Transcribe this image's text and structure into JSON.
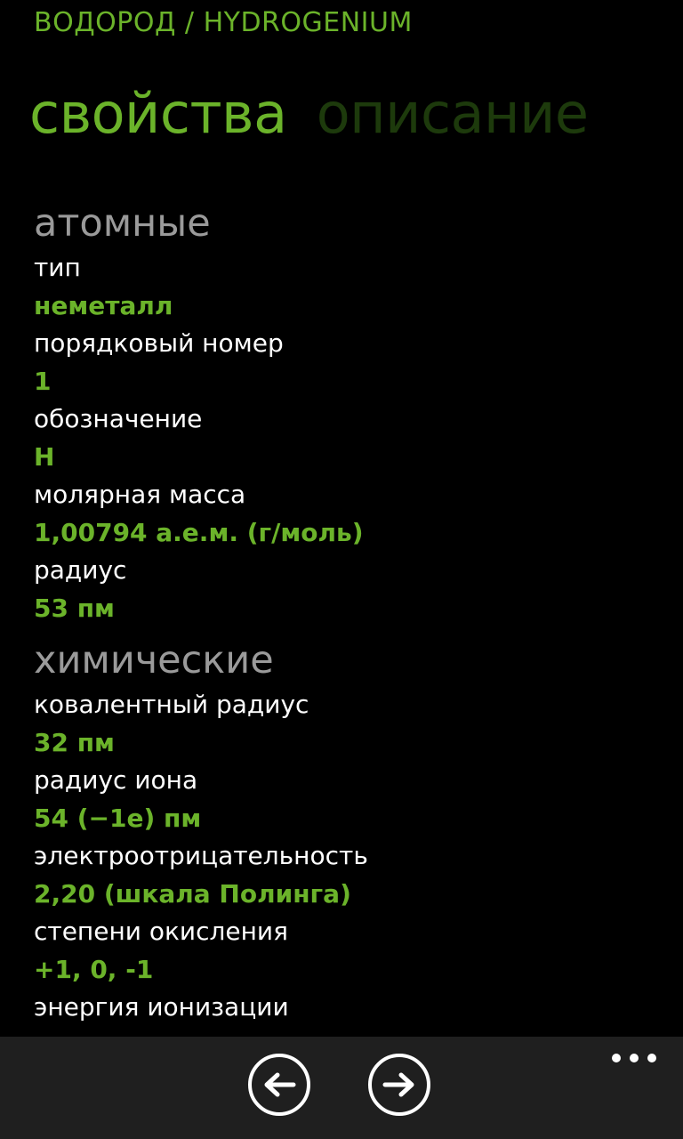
{
  "app": {
    "title": "ВОДОРОД / HYDROGENIUM"
  },
  "pivot": {
    "tabs": [
      {
        "label": "свойства",
        "active": true
      },
      {
        "label": "описание",
        "active": false
      }
    ]
  },
  "sections": [
    {
      "title": "атомные",
      "properties": [
        {
          "label": "тип",
          "value": "неметалл"
        },
        {
          "label": "порядковый номер",
          "value": "1"
        },
        {
          "label": "обозначение",
          "value": "H"
        },
        {
          "label": "молярная масса",
          "value": "1,00794 а.е.м. (г/моль)"
        },
        {
          "label": "радиус",
          "value": "53 пм"
        }
      ]
    },
    {
      "title": "химические",
      "properties": [
        {
          "label": "ковалентный радиус",
          "value": "32 пм"
        },
        {
          "label": "радиус иона",
          "value": "54 (−1e) пм"
        },
        {
          "label": "электроотрицательность",
          "value": "2,20 (шкала Полинга)"
        },
        {
          "label": "степени окисления",
          "value": "+1, 0, -1"
        },
        {
          "label": "энергия ионизации",
          "value": ""
        }
      ]
    }
  ],
  "app_bar": {
    "buttons": [
      {
        "icon": "arrow-left-icon"
      },
      {
        "icon": "arrow-right-icon"
      }
    ],
    "more_icon": "more-dots-icon"
  },
  "colors": {
    "accent": "#6bb32a",
    "inactive_tab": "#1d3a0c",
    "section_title": "#9a9a9a",
    "background": "#000000",
    "app_bar": "#1f1f1f"
  }
}
